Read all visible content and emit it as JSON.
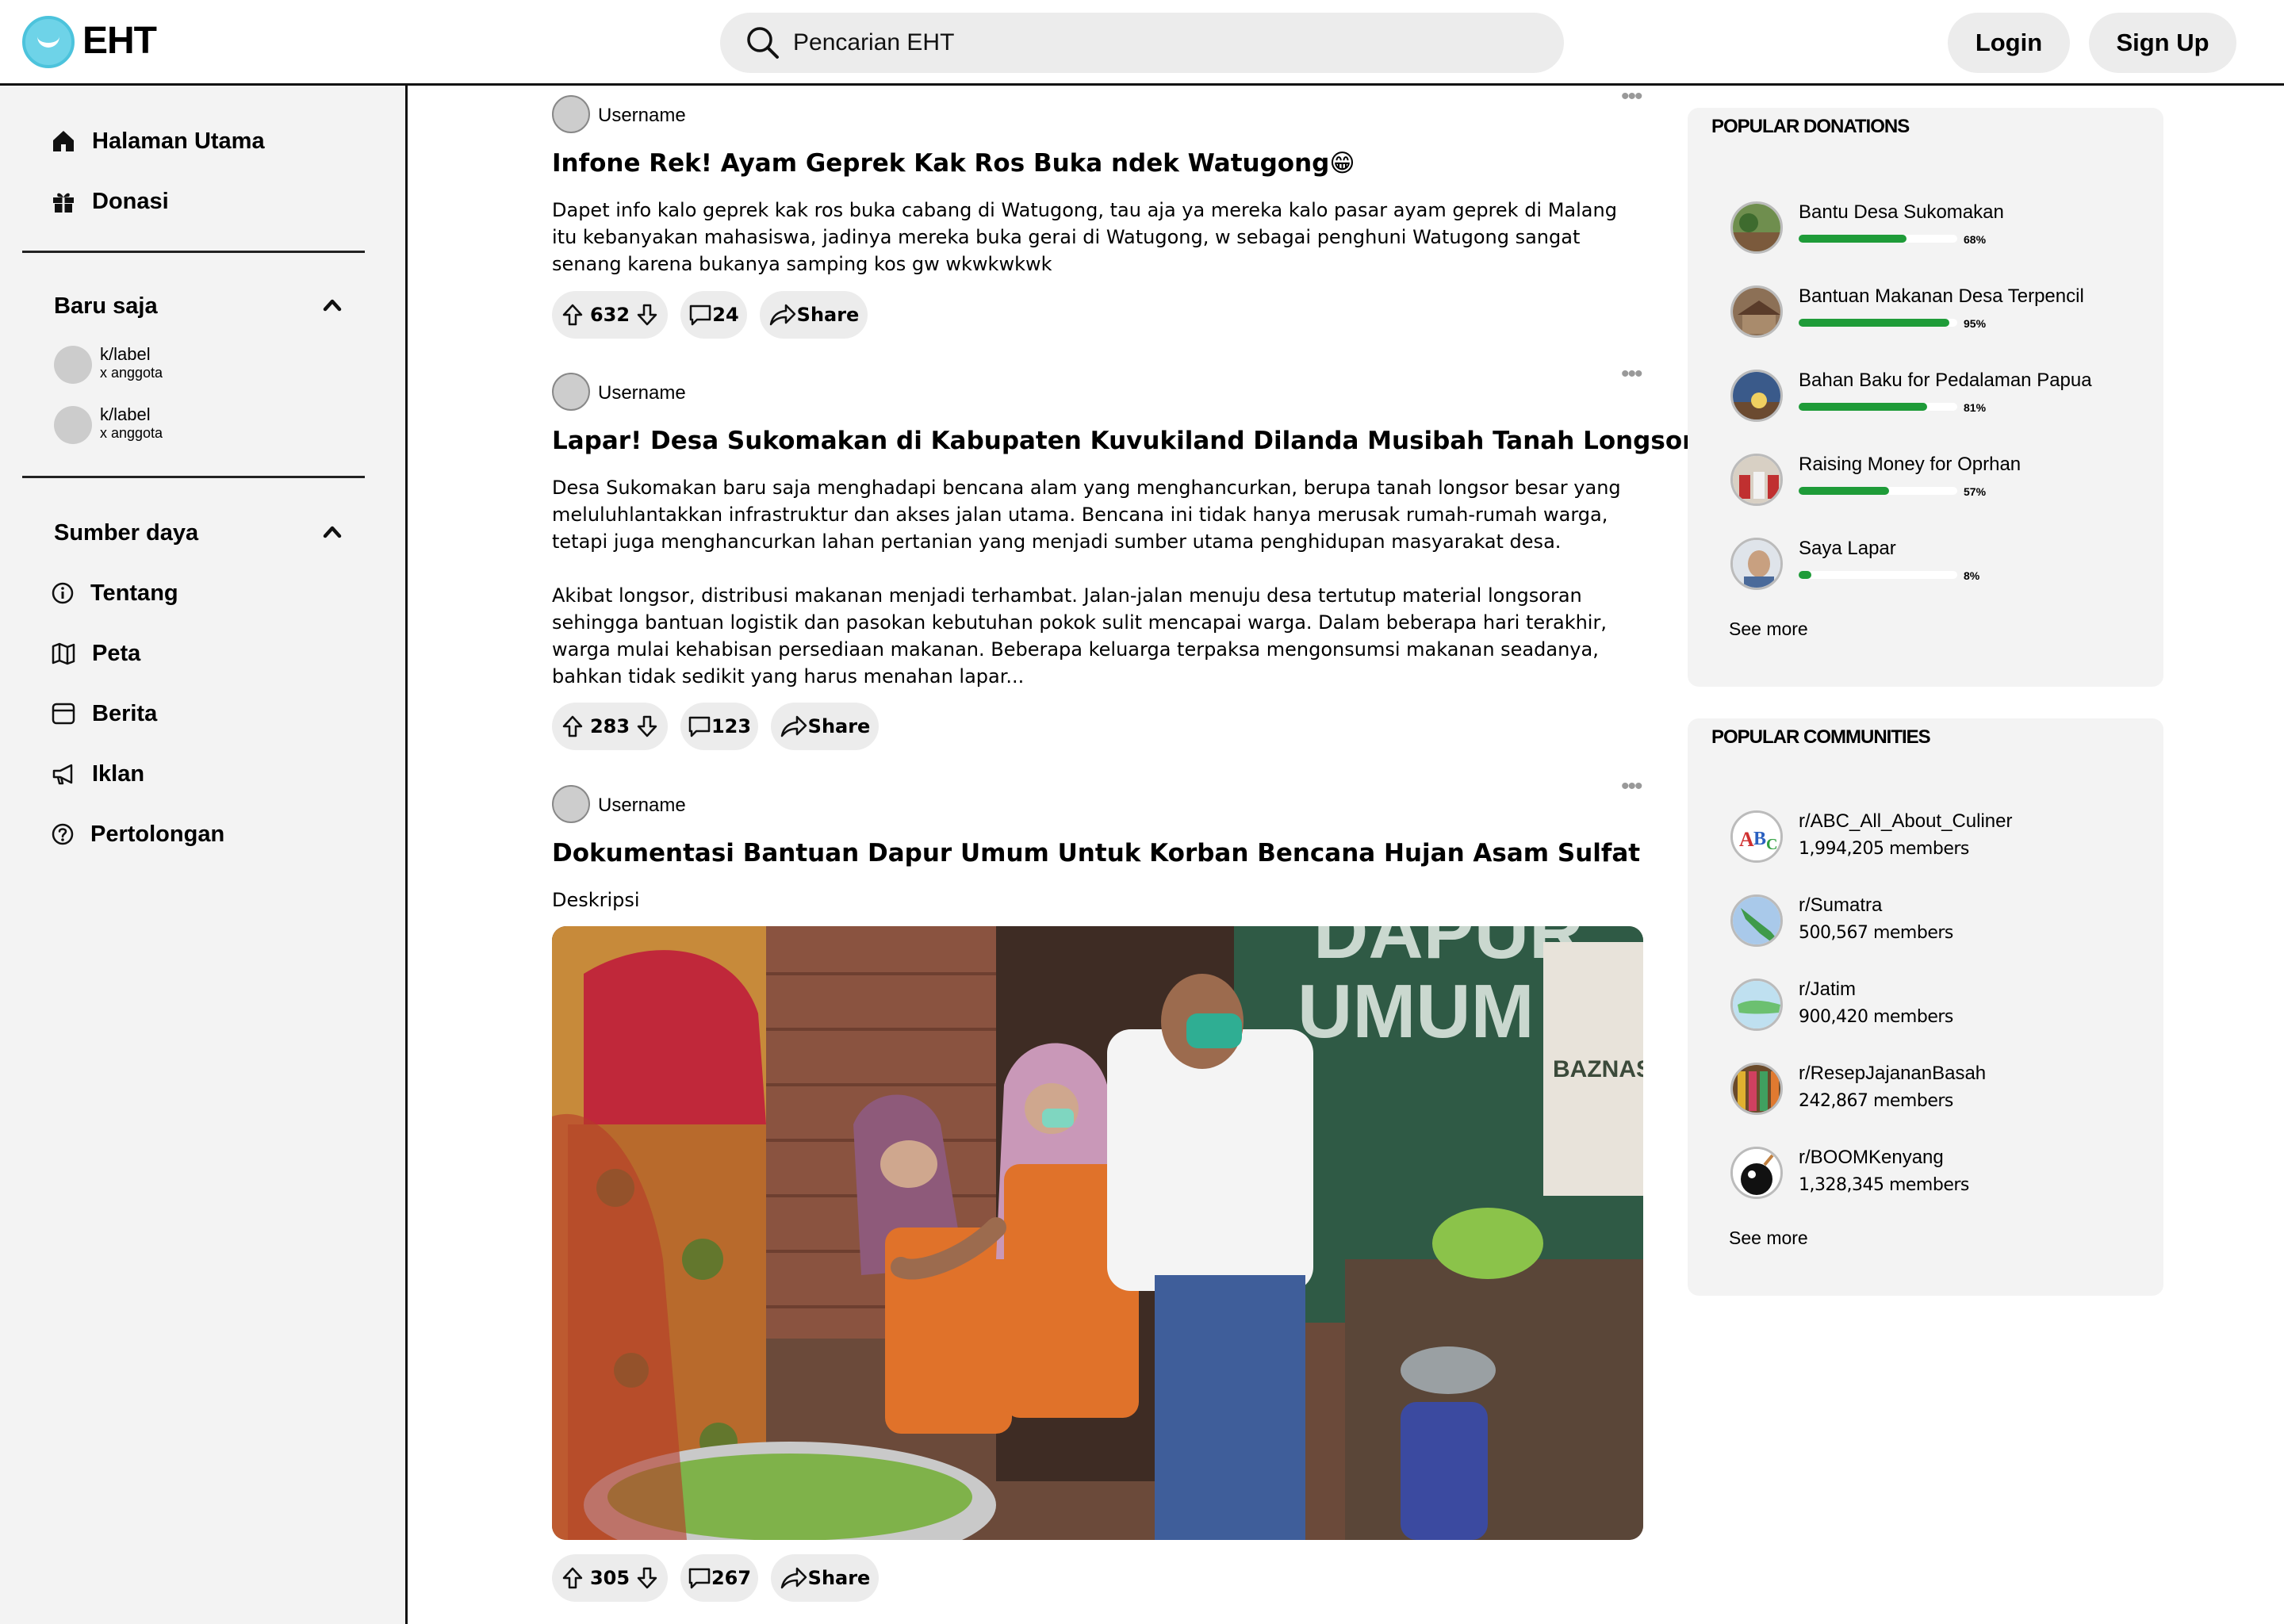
{
  "header": {
    "brand": "EHT",
    "search_placeholder": "Pencarian EHT",
    "login_label": "Login",
    "signup_label": "Sign Up"
  },
  "sidebar": {
    "main_nav": [
      {
        "label": "Halaman Utama",
        "icon": "home-icon"
      },
      {
        "label": "Donasi",
        "icon": "gift-icon"
      }
    ],
    "recent": {
      "title": "Baru saja",
      "items": [
        {
          "label": "k/label",
          "sub": "x anggota"
        },
        {
          "label": "k/label",
          "sub": "x anggota"
        }
      ]
    },
    "resources": {
      "title": "Sumber daya",
      "items": [
        {
          "label": "Tentang",
          "icon": "info-icon"
        },
        {
          "label": "Peta",
          "icon": "map-icon"
        },
        {
          "label": "Berita",
          "icon": "news-icon"
        },
        {
          "label": "Iklan",
          "icon": "megaphone-icon"
        },
        {
          "label": "Pertolongan",
          "icon": "help-icon"
        }
      ]
    }
  },
  "feed": {
    "posts": [
      {
        "username": "Username",
        "title": "Infone Rek! Ayam Geprek Kak Ros Buka ndek Watugong😁",
        "body": "Dapet info kalo geprek kak ros buka cabang di Watugong, tau aja ya mereka kalo pasar ayam geprek di Malang itu kebanyakan mahasiswa, jadinya mereka buka gerai di Watugong, w sebagai penghuni Watugong sangat senang karena bukanya samping kos gw wkwkwkwk",
        "votes": "632",
        "comments": "24",
        "share": "Share"
      },
      {
        "username": "Username",
        "title": "Lapar! Desa Sukomakan di Kabupaten Kuvukiland Dilanda Musibah Tanah Longsor",
        "body": "Desa Sukomakan baru saja menghadapi bencana alam yang menghancurkan, berupa tanah longsor besar yang meluluhlantakkan infrastruktur dan akses jalan utama. Bencana ini tidak hanya merusak rumah-rumah warga, tetapi juga menghancurkan lahan pertanian yang menjadi sumber utama penghidupan masyarakat desa.\n\nAkibat longsor, distribusi makanan menjadi terhambat. Jalan-jalan menuju desa tertutup material longsoran sehingga bantuan logistik dan pasokan kebutuhan pokok sulit mencapai warga. Dalam beberapa hari terakhir, warga mulai kehabisan persediaan makanan. Beberapa keluarga terpaksa mengonsumsi makanan seadanya, bahkan tidak sedikit yang harus menahan lapar...",
        "votes": "283",
        "comments": "123",
        "share": "Share"
      },
      {
        "username": "Username",
        "title": "Dokumentasi Bantuan Dapur Umum Untuk Korban Bencana Hujan Asam Sulfat",
        "body": "Deskripsi",
        "image_text_1": "DAPUR",
        "image_text_2": "UMUM",
        "image_text_3": "BAZNAS",
        "votes": "305",
        "comments": "267",
        "share": "Share"
      }
    ]
  },
  "popular_donations": {
    "title": "POPULAR DONATIONS",
    "items": [
      {
        "name": "Bantu Desa Sukomakan",
        "percent": "68%",
        "progress": 0.68
      },
      {
        "name": "Bantuan Makanan Desa Terpencil",
        "percent": "95%",
        "progress": 0.95
      },
      {
        "name": "Bahan Baku for Pedalaman Papua",
        "percent": "81%",
        "progress": 0.81
      },
      {
        "name": "Raising Money for Oprhan",
        "percent": "57%",
        "progress": 0.57
      },
      {
        "name": "Saya Lapar",
        "percent": "8%",
        "progress": 0.08
      }
    ],
    "see_more": "See more"
  },
  "popular_communities": {
    "title": "POPULAR COMMUNITIES",
    "items": [
      {
        "name": "r/ABC_All_About_Culiner",
        "members": "1,994,205 members"
      },
      {
        "name": "r/Sumatra",
        "members": "500,567 members"
      },
      {
        "name": "r/Jatim",
        "members": "900,420 members"
      },
      {
        "name": "r/ResepJajananBasah",
        "members": "242,867 members"
      },
      {
        "name": "r/BOOMKenyang",
        "members": "1,328,345 members"
      }
    ],
    "see_more": "See more"
  },
  "colors": {
    "progress": "#1e9b38",
    "panel": "#f3f3f3",
    "pill": "#ececec"
  }
}
